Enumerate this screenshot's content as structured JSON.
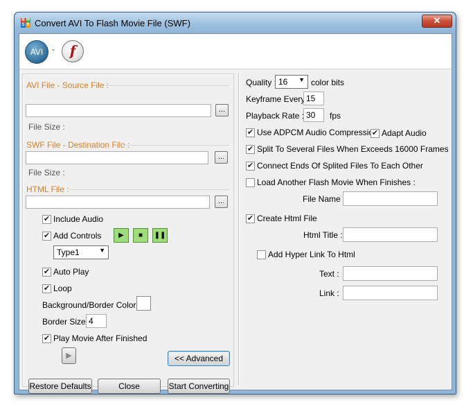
{
  "window": {
    "title": "Convert AVI To Flash Movie File (SWF)",
    "close_glyph": "✕"
  },
  "header": {
    "avi_logo": "AVI",
    "dash": "-",
    "flash_logo": "f"
  },
  "left": {
    "source_label": "AVI File - Source File :",
    "source_value": "",
    "source_size": "File Size :",
    "dest_label": "SWF File - Destination File :",
    "dest_value": "",
    "dest_size": "File Size :",
    "html_label": "HTML File :",
    "html_value": "",
    "browse": "...",
    "include_audio": {
      "label": "Include Audio",
      "checked": true
    },
    "add_controls": {
      "label": "Add Controls",
      "checked": true
    },
    "controls_type": "Type1",
    "auto_play": {
      "label": "Auto Play",
      "checked": true
    },
    "loop": {
      "label": "Loop",
      "checked": true
    },
    "bg_color_label": "Background/Border Color :",
    "border_size_label": "Border Size :",
    "border_size_value": "4",
    "play_after": {
      "label": "Play Movie After Finished",
      "checked": true
    },
    "advanced": "<< Advanced",
    "restore": "Restore Defaults",
    "close": "Close",
    "start": "Start Converting"
  },
  "right": {
    "quality_label": "Quality :",
    "quality_value": "16",
    "quality_unit": "color bits",
    "keyframe_label": "Keyframe Every :",
    "keyframe_value": "15",
    "playback_label": "Playback Rate :",
    "playback_value": "30",
    "playback_unit": "fps",
    "adpcm": {
      "label": "Use ADPCM Audio Compression",
      "checked": true
    },
    "adapt_audio": {
      "label": "Adapt Audio",
      "checked": true
    },
    "split": {
      "label": "Split To Several Files When Exceeds 16000 Frames",
      "checked": true
    },
    "connect": {
      "label": "Connect Ends Of Splited Files To Each Other",
      "checked": true
    },
    "load_another": {
      "label": "Load Another Flash Movie When Finishes :",
      "checked": false
    },
    "file_name_label": "File Name :",
    "create_html": {
      "label": "Create Html File",
      "checked": true
    },
    "html_title_label": "Html Title :",
    "hyperlink": {
      "label": "Add Hyper Link To Html",
      "checked": false
    },
    "text_label": "Text :",
    "link_label": "Link :"
  },
  "colors": {
    "accent_orange": "#d7802a",
    "control_green": "#9fdc7a",
    "border_color_swatch": "#ffffff"
  }
}
